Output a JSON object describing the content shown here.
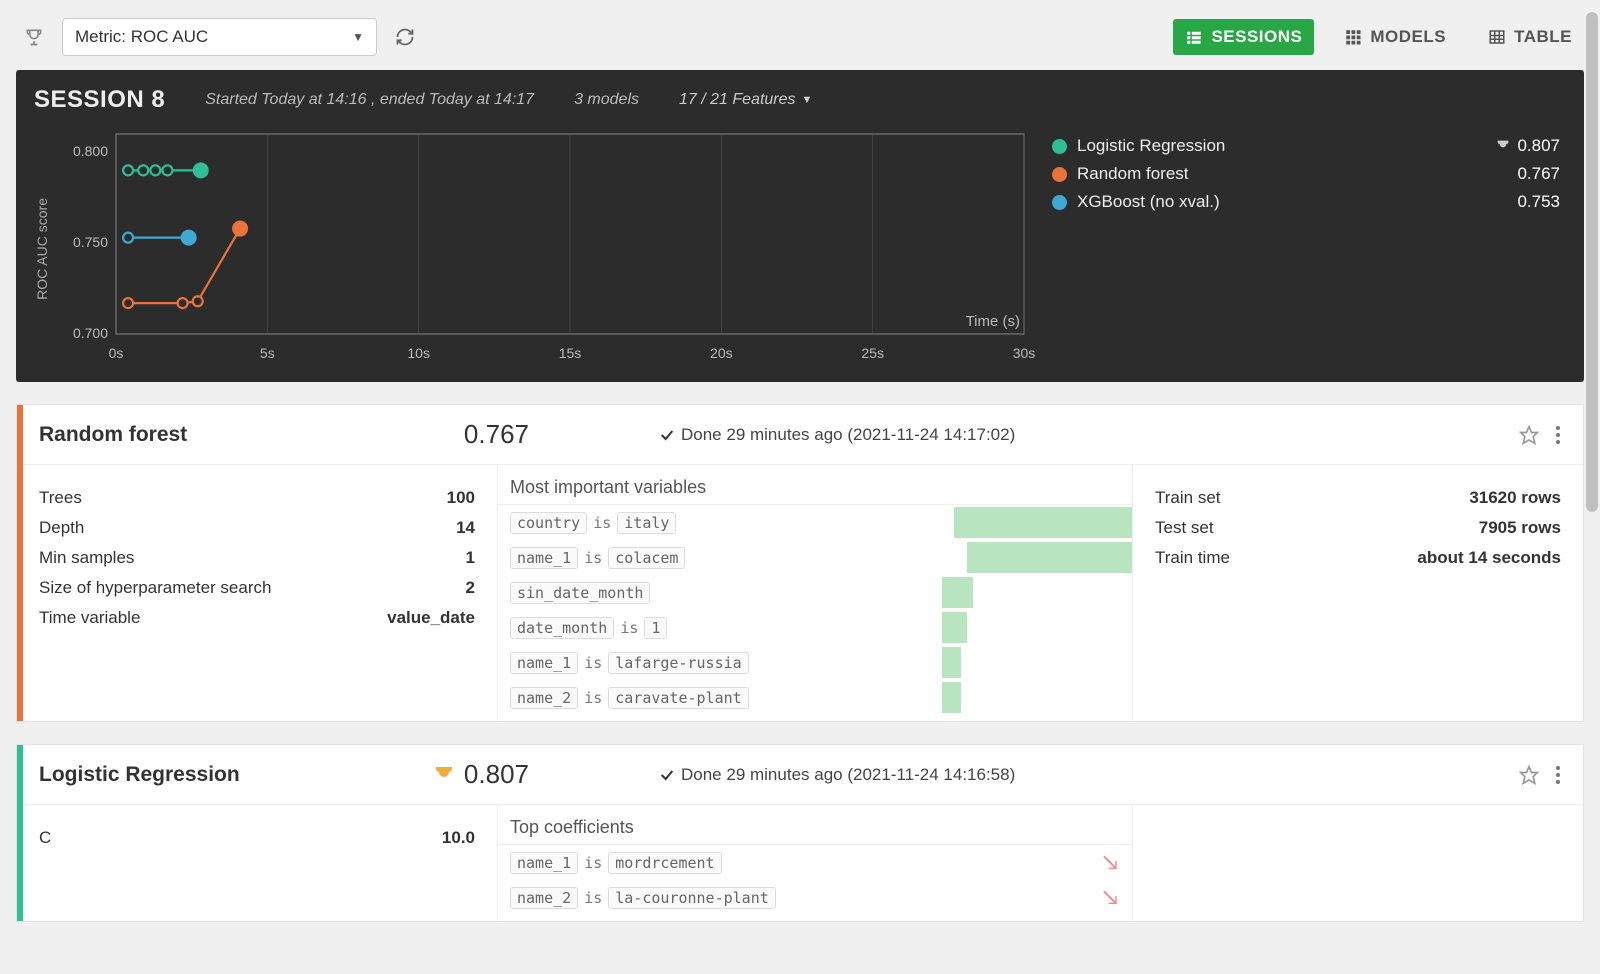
{
  "toolbar": {
    "metric_label_prefix": "Metric: ",
    "metric_value": "ROC AUC",
    "views": {
      "sessions": "SESSIONS",
      "models": "MODELS",
      "table": "TABLE"
    }
  },
  "session": {
    "title": "SESSION 8",
    "time_range": "Started Today at 14:16 , ended Today at 14:17",
    "models_count": "3 models",
    "features": "17 / 21 Features",
    "y_axis_label": "ROC AUC score",
    "x_axis_label": "Time (s)",
    "y_ticks": [
      "0.800",
      "0.750",
      "0.700"
    ],
    "x_ticks": [
      "0s",
      "5s",
      "10s",
      "15s",
      "20s",
      "25s",
      "30s"
    ],
    "legend": [
      {
        "name": "Logistic Regression",
        "color": "#2fbf95",
        "score": "0.807",
        "best": true
      },
      {
        "name": "Random forest",
        "color": "#e8743b",
        "score": "0.767",
        "best": false
      },
      {
        "name": "XGBoost (no xval.)",
        "color": "#3fa9d4",
        "score": "0.753",
        "best": false
      }
    ]
  },
  "chart_data": {
    "type": "line",
    "title": "",
    "xlabel": "Time (s)",
    "ylabel": "ROC AUC score",
    "ylim": [
      0.7,
      0.81
    ],
    "xlim": [
      0,
      30
    ],
    "series": [
      {
        "name": "Logistic Regression",
        "color": "#2fbf95",
        "x": [
          0.4,
          0.9,
          1.3,
          1.7,
          2.8
        ],
        "y": [
          0.79,
          0.79,
          0.79,
          0.79,
          0.79
        ],
        "final_point": {
          "x": 2.8,
          "y": 0.79,
          "filled": true
        }
      },
      {
        "name": "XGBoost (no xval.)",
        "color": "#3fa9d4",
        "x": [
          0.4,
          2.4
        ],
        "y": [
          0.753,
          0.753
        ],
        "final_point": {
          "x": 2.4,
          "y": 0.753,
          "filled": true
        }
      },
      {
        "name": "Random forest",
        "color": "#e8743b",
        "x": [
          0.4,
          2.2,
          2.7,
          4.1
        ],
        "y": [
          0.717,
          0.717,
          0.718,
          0.758
        ],
        "final_point": {
          "x": 4.1,
          "y": 0.758,
          "filled": true
        }
      }
    ]
  },
  "models": [
    {
      "stripe": "#e8743b",
      "name": "Random forest",
      "score": "0.767",
      "best": false,
      "status_prefix": "Done ",
      "status_ago": "29 minutes ago",
      "status_ts": " (2021-11-24 14:17:02)",
      "params": [
        {
          "k": "Trees",
          "v": "100"
        },
        {
          "k": "Depth",
          "v": "14"
        },
        {
          "k": "Min samples",
          "v": "1"
        },
        {
          "k": "Size of hyperparameter search",
          "v": "2"
        },
        {
          "k": "Time variable",
          "v": "value_date"
        }
      ],
      "vars_title": "Most important variables",
      "vars": [
        {
          "codes": [
            "country",
            "is",
            "italy"
          ],
          "bar_pct": 28,
          "from_right": true
        },
        {
          "codes": [
            "name_1",
            "is",
            "colacem"
          ],
          "bar_pct": 26,
          "from_right": true
        },
        {
          "codes": [
            "sin_date_month"
          ],
          "bar_pct": 5,
          "from_right": false
        },
        {
          "codes": [
            "date_month",
            "is",
            "1"
          ],
          "bar_pct": 4,
          "from_right": false
        },
        {
          "codes": [
            "name_1",
            "is",
            "lafarge-russia"
          ],
          "bar_pct": 3,
          "from_right": false
        },
        {
          "codes": [
            "name_2",
            "is",
            "caravate-plant"
          ],
          "bar_pct": 3,
          "from_right": false
        }
      ],
      "stats": [
        {
          "k": "Train set",
          "v": "31620 rows"
        },
        {
          "k": "Test set",
          "v": "7905 rows"
        },
        {
          "k": "Train time",
          "v": "about 14 seconds"
        }
      ]
    },
    {
      "stripe": "#2fbf95",
      "name": "Logistic Regression",
      "score": "0.807",
      "best": true,
      "status_prefix": "Done ",
      "status_ago": "29 minutes ago",
      "status_ts": " (2021-11-24 14:16:58)",
      "params": [
        {
          "k": "C",
          "v": "10.0"
        }
      ],
      "vars_title": "Top coefficients",
      "vars": [
        {
          "codes": [
            "name_1",
            "is",
            "mordrcement"
          ],
          "bar_pct": 0,
          "negative": true
        },
        {
          "codes": [
            "name_2",
            "is",
            "la-couronne-plant"
          ],
          "bar_pct": 0,
          "negative": true
        }
      ],
      "stats": []
    }
  ]
}
